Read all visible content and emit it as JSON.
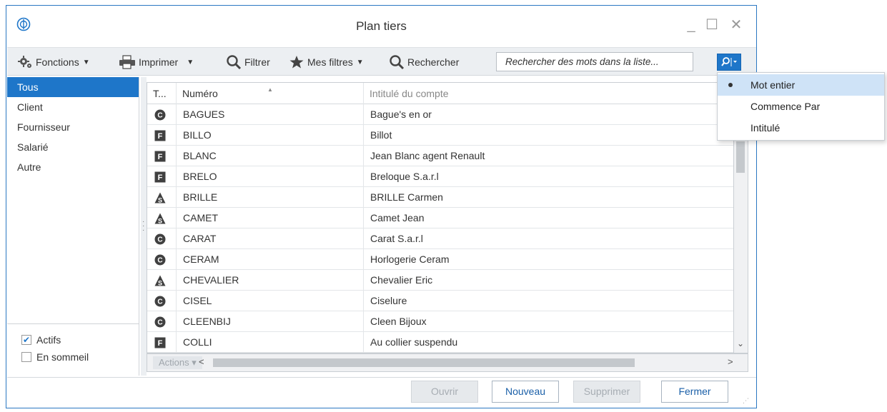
{
  "window": {
    "title": "Plan tiers"
  },
  "toolbar": {
    "functions_label": "Fonctions",
    "print_label": "Imprimer",
    "filter_label": "Filtrer",
    "my_filters_label": "Mes filtres",
    "search_label": "Rechercher",
    "search_placeholder": "Rechercher des mots dans la liste..."
  },
  "sidebar": {
    "categories": [
      {
        "label": "Tous",
        "selected": true
      },
      {
        "label": "Client"
      },
      {
        "label": "Fournisseur"
      },
      {
        "label": "Salarié"
      },
      {
        "label": "Autre"
      }
    ],
    "checkboxes": [
      {
        "label": "Actifs",
        "checked": true
      },
      {
        "label": "En sommeil",
        "checked": false
      }
    ]
  },
  "grid": {
    "headers": {
      "type": "T...",
      "number": "Numéro",
      "title": "Intitulé du compte"
    },
    "rows": [
      {
        "type": "C",
        "icon": "client-icon",
        "number": "BAGUES",
        "title": "Bague's en or"
      },
      {
        "type": "F",
        "icon": "supplier-icon",
        "number": "BILLO",
        "title": "Billot"
      },
      {
        "type": "F",
        "icon": "supplier-icon",
        "number": "BLANC",
        "title": "Jean Blanc agent Renault"
      },
      {
        "type": "F",
        "icon": "supplier-icon",
        "number": "BRELO",
        "title": "Breloque S.a.r.l"
      },
      {
        "type": "S",
        "icon": "employee-icon",
        "number": "BRILLE",
        "title": "BRILLE Carmen"
      },
      {
        "type": "S",
        "icon": "employee-icon",
        "number": "CAMET",
        "title": "Camet Jean"
      },
      {
        "type": "C",
        "icon": "client-icon",
        "number": "CARAT",
        "title": "Carat S.a.r.l"
      },
      {
        "type": "C",
        "icon": "client-icon",
        "number": "CERAM",
        "title": "Horlogerie Ceram"
      },
      {
        "type": "S",
        "icon": "employee-icon",
        "number": "CHEVALIER",
        "title": "Chevalier Eric"
      },
      {
        "type": "C",
        "icon": "client-icon",
        "number": "CISEL",
        "title": "Ciselure"
      },
      {
        "type": "C",
        "icon": "client-icon",
        "number": "CLEENBIJ",
        "title": "Cleen Bijoux"
      },
      {
        "type": "F",
        "icon": "supplier-icon",
        "number": "COLLI",
        "title": "Au collier suspendu"
      }
    ],
    "actions_label": "Actions"
  },
  "footer": {
    "open_label": "Ouvrir",
    "new_label": "Nouveau",
    "delete_label": "Supprimer",
    "close_label": "Fermer"
  },
  "search_menu": {
    "items": [
      {
        "label": "Mot entier",
        "selected": true
      },
      {
        "label": "Commence Par"
      },
      {
        "label": "Intitulé"
      }
    ]
  },
  "colors": {
    "accent": "#1e76c9"
  }
}
